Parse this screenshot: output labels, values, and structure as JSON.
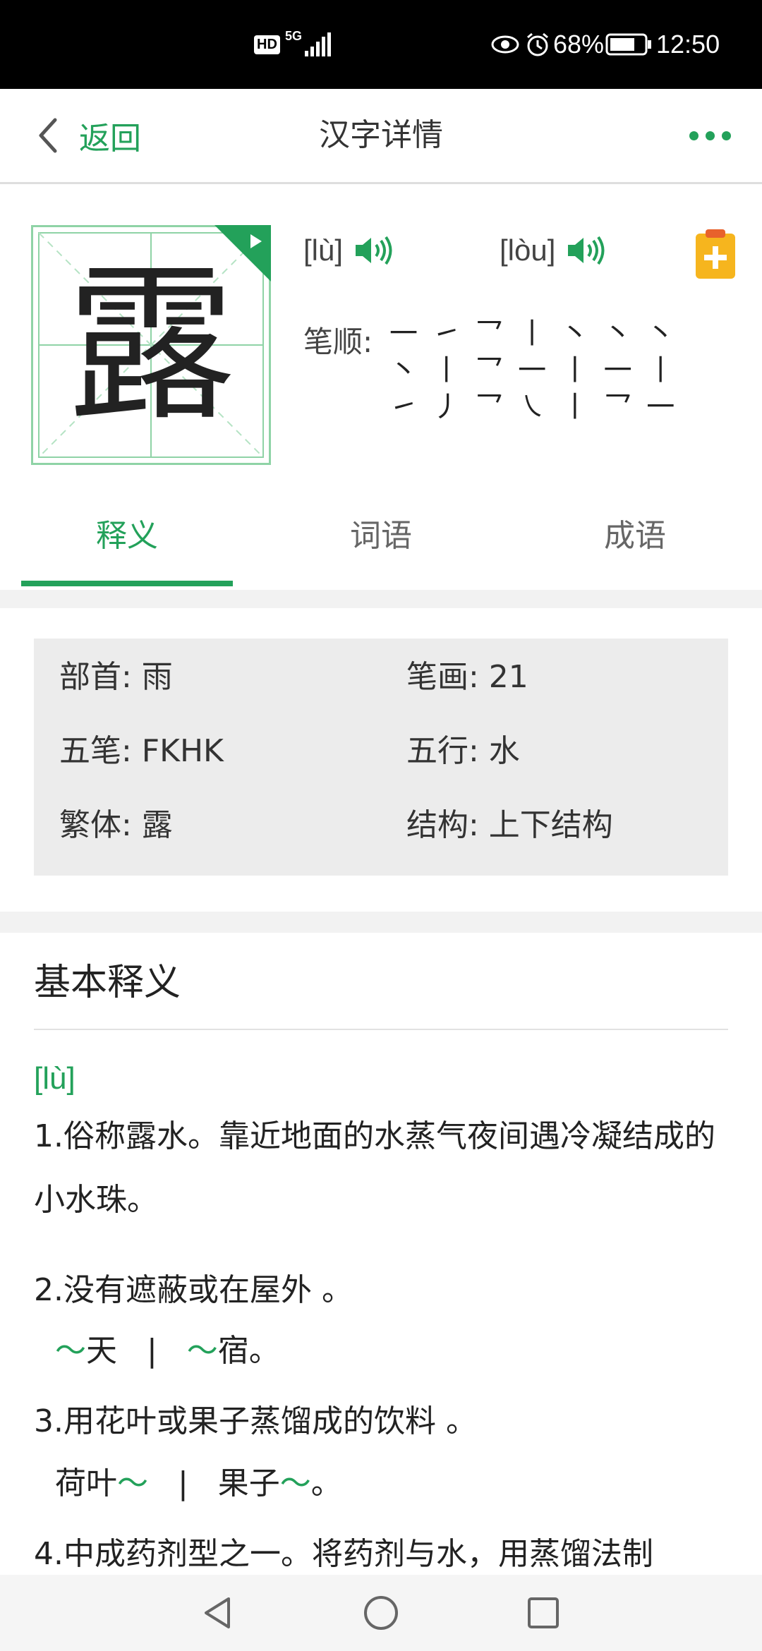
{
  "status_bar": {
    "network_hd": "HD",
    "network_5g": "5G",
    "battery": "68%",
    "time": "12:50"
  },
  "header": {
    "back_label": "返回",
    "title": "汉字详情"
  },
  "character": {
    "glyph": "露",
    "pronunciations": [
      {
        "pinyin": "[lù]"
      },
      {
        "pinyin": "[lòu]"
      }
    ],
    "stroke_order_label": "笔顺:",
    "strokes": "一 ㇀ 乛 丨 丶 丶 丶 丶 丨 乛 一 丨 一 丨 ㇀ 丿 乛 ㇏ 丨 乛 一"
  },
  "tabs": [
    {
      "label": "释义",
      "active": true
    },
    {
      "label": "词语",
      "active": false
    },
    {
      "label": "成语",
      "active": false
    }
  ],
  "info": {
    "radical": "部首: 雨",
    "strokes": "笔画: 21",
    "wubi": "五笔: FKHK",
    "wuxing": "五行: 水",
    "traditional": "繁体: 露",
    "structure": "结构: 上下结构"
  },
  "definitions": {
    "title": "基本释义",
    "pinyin": "[lù]",
    "items": [
      {
        "text": "1.俗称露水。靠近地面的水蒸气夜间遇冷凝结成的小水珠。"
      },
      {
        "text": "2.没有遮蔽或在屋外 。",
        "examples": [
          "～天",
          "～宿。"
        ]
      },
      {
        "text": "3.用花叶或果子蒸馏成的饮料 。",
        "examples": [
          "荷叶～",
          "果子～。"
        ]
      },
      {
        "text": "4.中成药剂型之一。将药剂与水，用蒸馏法制"
      }
    ]
  },
  "colors": {
    "accent": "#23a15a",
    "status_bar": "#000000",
    "info_bg": "#ececec"
  },
  "icons": [
    "chevron-left-icon",
    "more-dots-icon",
    "speaker-icon",
    "clipboard-add-icon",
    "play-icon",
    "nav-back-icon",
    "nav-home-icon",
    "nav-recent-icon"
  ]
}
